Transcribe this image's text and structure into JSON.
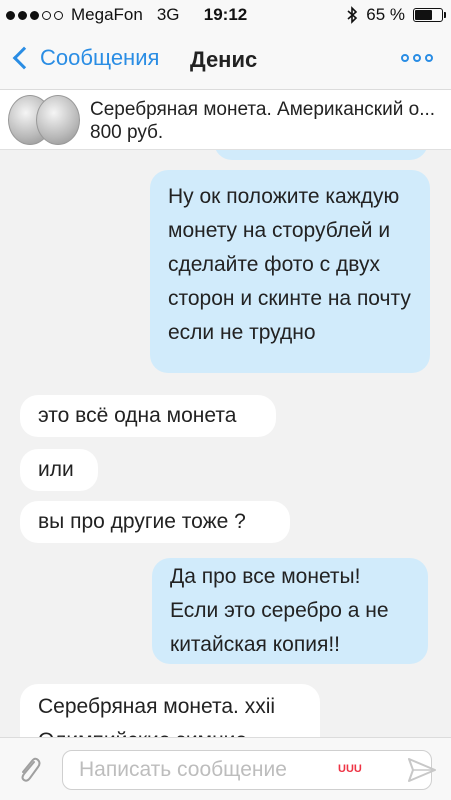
{
  "status_bar": {
    "carrier": "MegaFon",
    "network": "3G",
    "time": "19:12",
    "battery_percent": "65 %",
    "battery_level": 0.65,
    "signal_bars": 3,
    "signal_total": 5
  },
  "nav": {
    "back_label": "Сообщения",
    "title": "Денис",
    "more_icon": "more-dots-icon",
    "accent_color": "#2a8de4"
  },
  "item": {
    "title": "Серебряная монета. Американский о...",
    "price": "800 руб."
  },
  "messages": [
    {
      "direction": "outgoing",
      "text": "Ну ок положите каждую монету на сторублей и сделайте фото с двух сторон и скинте на почту если не трудно"
    },
    {
      "direction": "incoming",
      "text": "это всё одна монета"
    },
    {
      "direction": "incoming",
      "text": "или"
    },
    {
      "direction": "incoming",
      "text": "вы про другие тоже ?"
    },
    {
      "direction": "outgoing",
      "text": "Да про все монеты! Если это серебро а не китайская копия!!"
    },
    {
      "direction": "incoming",
      "text": "Серебряная монета. xxii Олимпийские зимние"
    }
  ],
  "input": {
    "placeholder": "Написать сообщение"
  },
  "watermark": "UUU"
}
